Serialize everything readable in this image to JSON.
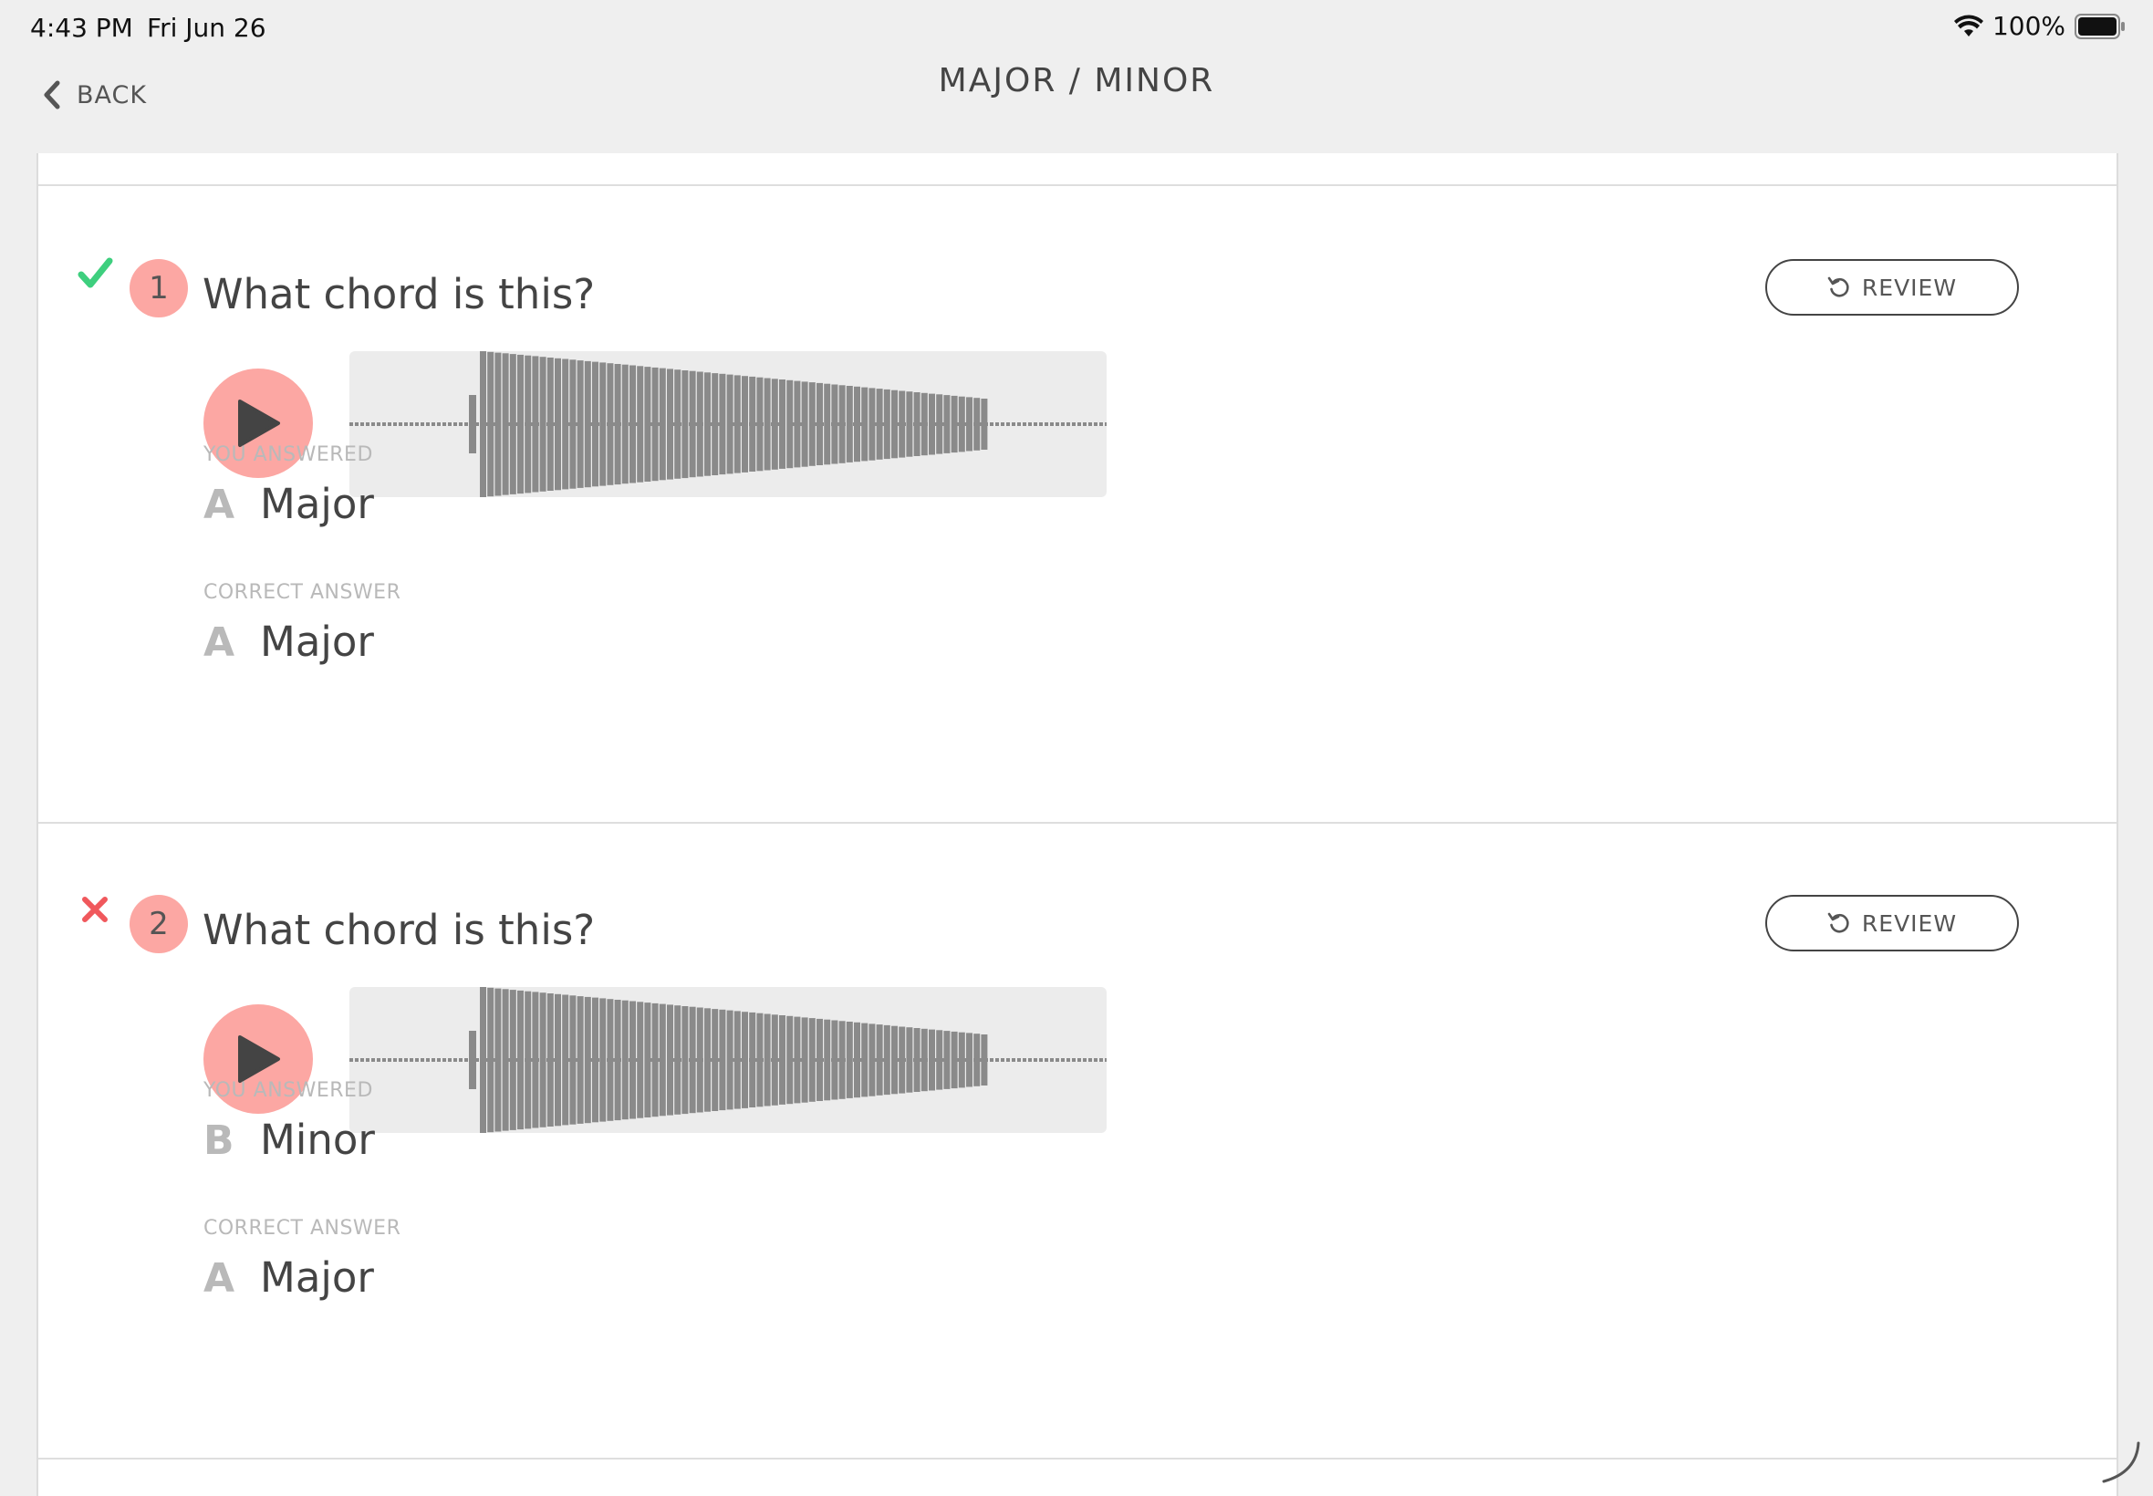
{
  "status_bar": {
    "time": "4:43 PM",
    "date": "Fri Jun 26",
    "battery": "100%"
  },
  "nav": {
    "back_label": "BACK",
    "title": "MAJOR / MINOR"
  },
  "colors": {
    "accent": "#fca7a3",
    "correct": "#3ecf7e",
    "wrong": "#f0585c"
  },
  "questions": [
    {
      "number": "1",
      "status": "correct",
      "prompt": "What chord is this?",
      "review_label": "REVIEW",
      "you_answered_label": "YOU ANSWERED",
      "you_answered": {
        "letter": "A",
        "text": "Major"
      },
      "correct_label": "CORRECT ANSWER",
      "correct": {
        "letter": "A",
        "text": "Major"
      }
    },
    {
      "number": "2",
      "status": "wrong",
      "prompt": "What chord is this?",
      "review_label": "REVIEW",
      "you_answered_label": "YOU ANSWERED",
      "you_answered": {
        "letter": "B",
        "text": "Minor"
      },
      "correct_label": "CORRECT ANSWER",
      "correct": {
        "letter": "A",
        "text": "Major"
      }
    }
  ]
}
